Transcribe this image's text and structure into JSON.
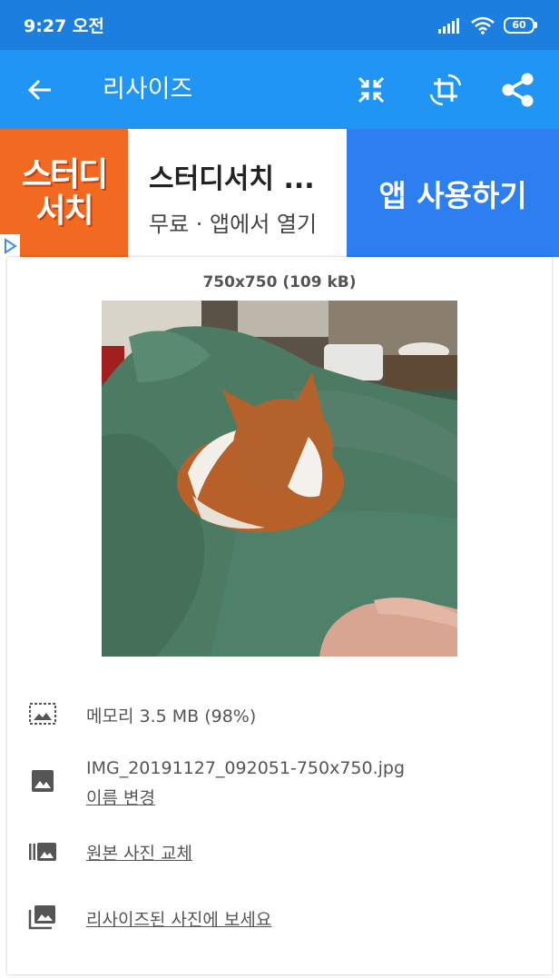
{
  "status_bar": {
    "time": "9:27 오전",
    "battery": "60"
  },
  "app_bar": {
    "title": "리사이즈",
    "back_icon": "arrow-left-icon",
    "actions": [
      "compress-icon",
      "rotate-icon",
      "share-icon"
    ]
  },
  "ad": {
    "logo_line1": "스터디",
    "logo_line2": "서치",
    "title": "스터디서치 ...",
    "subtitle": "무료 · 앱에서 열기",
    "cta": "앱 사용하기"
  },
  "image": {
    "dimensions": "750x750 (109 kB)"
  },
  "info": {
    "memory": "메모리 3.5 MB (98%)",
    "filename": "IMG_20191127_092051-750x750.jpg",
    "rename": "이름 변경",
    "replace": "원본 사진 교체",
    "view": "리사이즈된 사진에 보세요"
  },
  "colors": {
    "status_bar": "#1c7fdf",
    "app_bar": "#2195f3",
    "ad_logo": "#f26a21",
    "ad_cta": "#2d7ef0"
  }
}
